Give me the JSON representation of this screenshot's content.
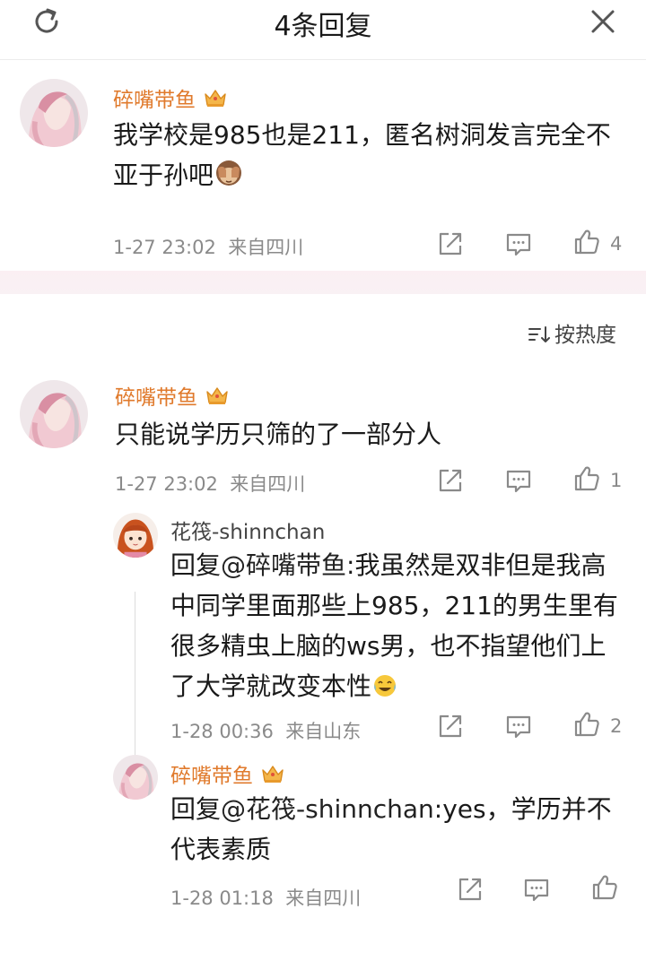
{
  "header": {
    "title": "4条回复"
  },
  "icons": {
    "refresh": "refresh-icon",
    "close": "close-icon",
    "share": "share-icon",
    "comment": "comment-icon",
    "like": "thumbs-up-icon",
    "crown": "crown-icon",
    "sort": "sort-icon"
  },
  "colors": {
    "username": "#e07a2c",
    "meta": "#8a8a8a",
    "band": "#fbeff3"
  },
  "root_comment": {
    "username": "碎嘴带鱼",
    "text": "我学校是985也是211，匿名树洞发言完全不亚于孙吧",
    "emoji": "see-no-evil-monkey",
    "timestamp": "1-27 23:02",
    "location": "来自四川",
    "likes": "4"
  },
  "sort_label": "按热度",
  "comments": [
    {
      "username": "碎嘴带鱼",
      "text": "只能说学历只筛的了一部分人",
      "timestamp": "1-27 23:02",
      "location": "来自四川",
      "likes": "1"
    }
  ],
  "replies": [
    {
      "username": "花筏-shinnchan",
      "reply_prefix": "回复",
      "mention": "@碎嘴带鱼",
      "text": ":我虽然是双非但是我高中同学里面那些上985，211的男生里有很多精虫上脑的ws男，也不指望他们上了大学就改变本性",
      "emoji": "laughing-crying-face",
      "timestamp": "1-28 00:36",
      "location": "来自山东",
      "likes": "2"
    },
    {
      "username": "碎嘴带鱼",
      "reply_prefix": "回复",
      "mention": "@花筏-shinnchan",
      "text": ":yes，学历并不代表素质",
      "timestamp": "1-28 01:18",
      "location": "来自四川",
      "likes": ""
    }
  ]
}
